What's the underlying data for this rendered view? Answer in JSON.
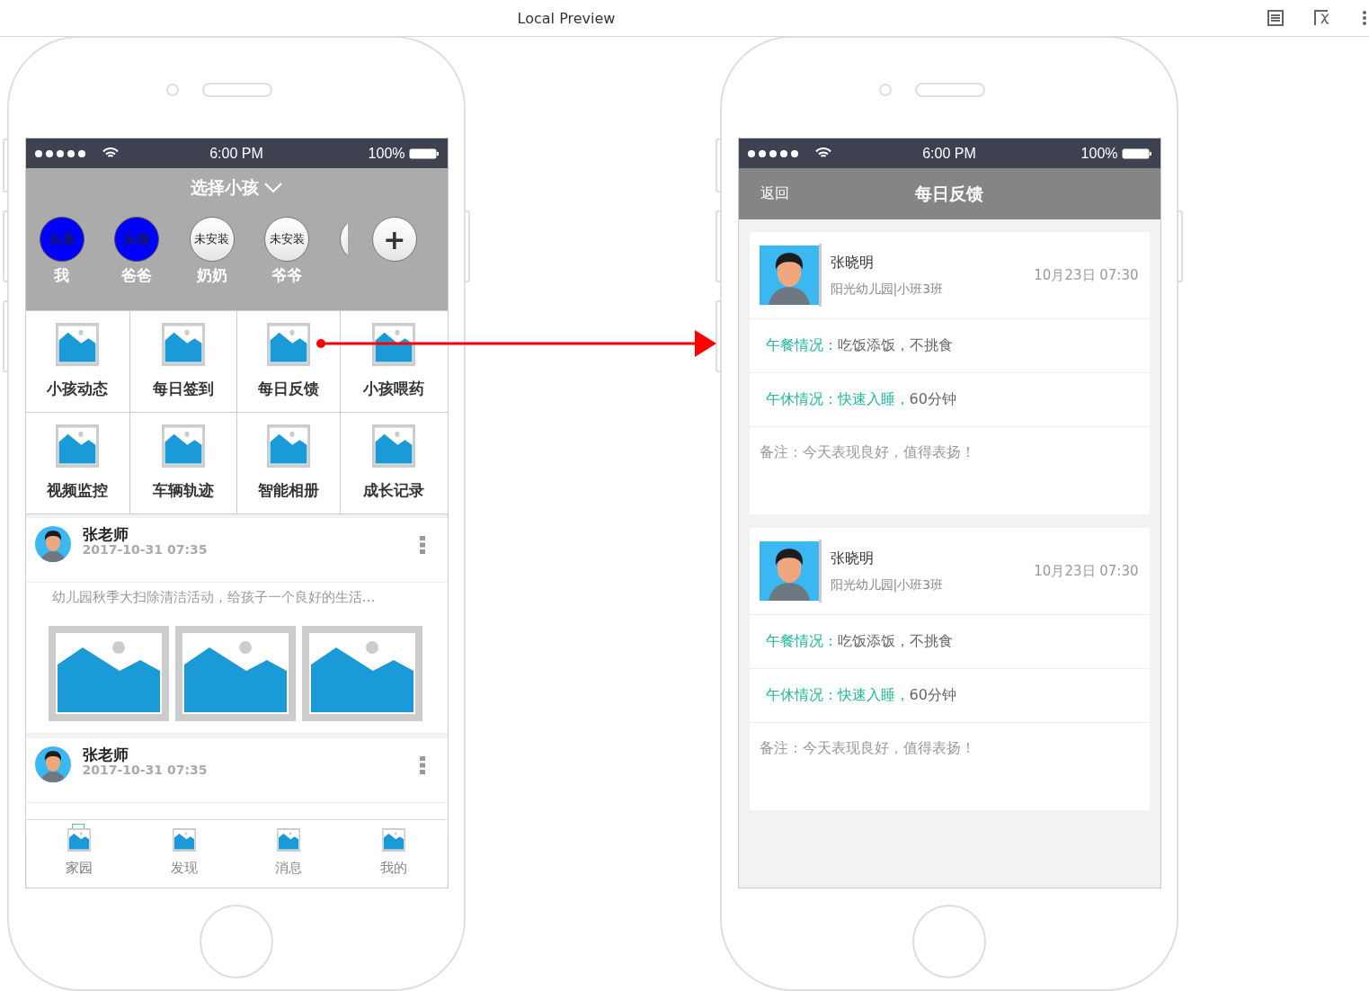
{
  "preview_bar": {
    "title": "Local Preview"
  },
  "home_screen": {
    "status_bar": {
      "time": "6:00 PM",
      "battery": "100%"
    },
    "header": {
      "title": "选择小孩"
    },
    "family": [
      {
        "kind": "photo",
        "avatar": "头像",
        "name": "我"
      },
      {
        "kind": "photo",
        "avatar": "头像",
        "name": "爸爸"
      },
      {
        "kind": "empty",
        "avatar": "未安装",
        "name": "奶奶"
      },
      {
        "kind": "empty",
        "avatar": "未安装",
        "name": "爷爷"
      },
      {
        "kind": "partial"
      }
    ],
    "add_button": "+",
    "menu": [
      "小孩动态",
      "每日签到",
      "每日反馈",
      "小孩喂药",
      "视频监控",
      "车辆轨迹",
      "智能相册",
      "成长记录"
    ],
    "posts": [
      {
        "author": "张老师",
        "time": "2017-10-31 07:35",
        "text": "幼儿园秋季大扫除清洁活动，给孩子一个良好的生活…"
      },
      {
        "author": "张老师",
        "time": "2017-10-31 07:35"
      }
    ],
    "tab_bar": [
      {
        "label": "家园",
        "selected": true
      },
      {
        "label": "发现",
        "selected": false
      },
      {
        "label": "消息",
        "selected": false
      },
      {
        "label": "我的",
        "selected": false
      }
    ]
  },
  "feedback_screen": {
    "status_bar": {
      "time": "6:00 PM",
      "battery": "100%"
    },
    "nav": {
      "back": "返回",
      "title": "每日反馈"
    },
    "cards": [
      {
        "name": "张晓明",
        "school": "阳光幼儿园|小班3班",
        "time": "10月23日 07:30",
        "rows": [
          {
            "kind": "status",
            "parts": [
              {
                "text": "午餐情况：",
                "highlight": true
              },
              {
                "text": "吃饭添饭，不挑食",
                "highlight": false
              }
            ]
          },
          {
            "kind": "status",
            "parts": [
              {
                "text": "午休情况：快速入睡，",
                "highlight": true
              },
              {
                "text": "60分钟",
                "highlight": false
              }
            ]
          },
          {
            "kind": "note",
            "parts": [
              {
                "text": "备注：今天表现良好，值得表扬！"
              }
            ]
          }
        ]
      },
      {
        "name": "张晓明",
        "school": "阳光幼儿园|小班3班",
        "time": "10月23日 07:30",
        "rows": [
          {
            "kind": "status",
            "parts": [
              {
                "text": "午餐情况：",
                "highlight": true
              },
              {
                "text": "吃饭添饭，不挑食",
                "highlight": false
              }
            ]
          },
          {
            "kind": "status",
            "parts": [
              {
                "text": "午休情况：快速入睡，",
                "highlight": true
              },
              {
                "text": "60分钟",
                "highlight": false
              }
            ]
          },
          {
            "kind": "note",
            "parts": [
              {
                "text": "备注：今天表现良好，值得表扬！"
              }
            ]
          }
        ]
      }
    ]
  }
}
